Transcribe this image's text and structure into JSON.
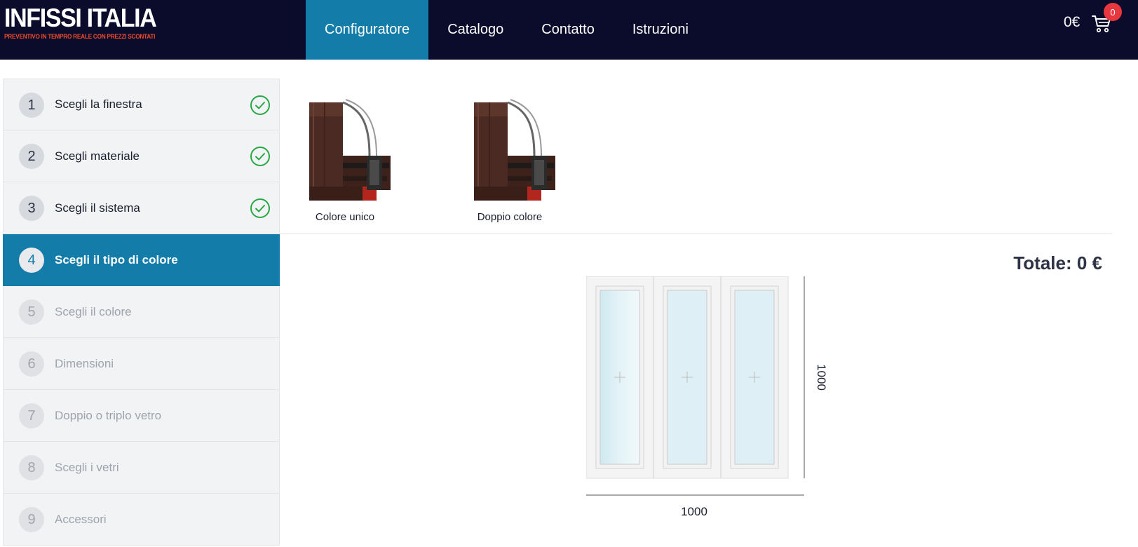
{
  "brand": {
    "title": "INFISSI ITALIA",
    "subtitle": "PREVENTIVO IN TEMPRO REALE CON PREZZI SCONTATI"
  },
  "nav": {
    "items": [
      {
        "label": "Configuratore",
        "active": true
      },
      {
        "label": "Catalogo",
        "active": false
      },
      {
        "label": "Contatto",
        "active": false
      },
      {
        "label": "Istruzioni",
        "active": false
      }
    ]
  },
  "cart": {
    "price": "0€",
    "count": "0"
  },
  "steps": [
    {
      "number": "1",
      "label": "Scegli la finestra",
      "state": "done"
    },
    {
      "number": "2",
      "label": "Scegli materiale",
      "state": "done"
    },
    {
      "number": "3",
      "label": "Scegli il sistema",
      "state": "done"
    },
    {
      "number": "4",
      "label": "Scegli il tipo di colore",
      "state": "active"
    },
    {
      "number": "5",
      "label": "Scegli il colore",
      "state": "disabled"
    },
    {
      "number": "6",
      "label": "Dimensioni",
      "state": "disabled"
    },
    {
      "number": "7",
      "label": "Doppio o triplo vetro",
      "state": "disabled"
    },
    {
      "number": "8",
      "label": "Scegli i vetri",
      "state": "disabled"
    },
    {
      "number": "9",
      "label": "Accessori",
      "state": "disabled"
    }
  ],
  "options": [
    {
      "caption": "Colore unico"
    },
    {
      "caption": "Doppio colore"
    }
  ],
  "summary": {
    "total": "Totale: 0 €",
    "width": "1000",
    "height": "1000"
  },
  "colors": {
    "header_bg": "#0b0c2c",
    "accent": "#147ca8",
    "badge": "#e8373e",
    "check": "#28a745"
  }
}
